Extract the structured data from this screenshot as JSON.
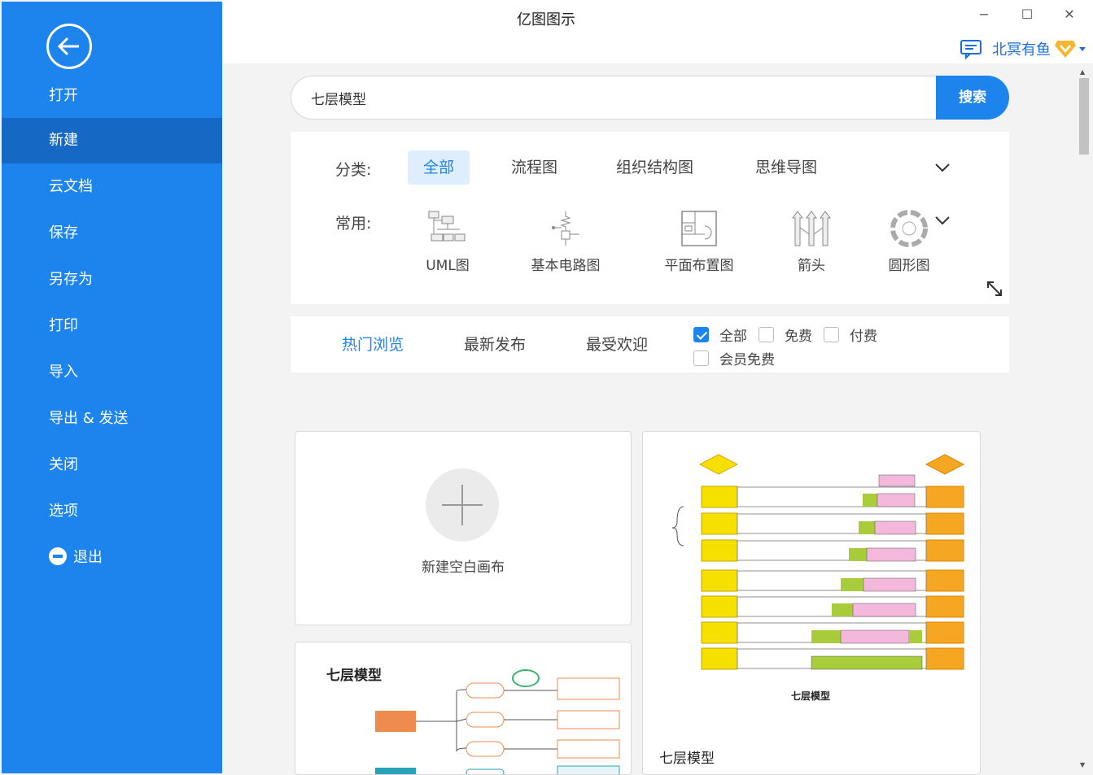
{
  "app": {
    "title": "亿图图示"
  },
  "window": {
    "minimize": "−",
    "maximize": "☐",
    "close": "✕"
  },
  "user": {
    "name": "北冥有鱼"
  },
  "sidebar": {
    "items": [
      {
        "label": "打开"
      },
      {
        "label": "新建"
      },
      {
        "label": "云文档"
      },
      {
        "label": "保存"
      },
      {
        "label": "另存为"
      },
      {
        "label": "打印"
      },
      {
        "label": "导入"
      },
      {
        "label": "导出 & 发送"
      },
      {
        "label": "关闭"
      },
      {
        "label": "选项"
      },
      {
        "label": "退出"
      }
    ],
    "active": "新建"
  },
  "search": {
    "value": "七层模型",
    "button": "搜索"
  },
  "category": {
    "label": "分类:",
    "tabs": [
      {
        "label": "全部"
      },
      {
        "label": "流程图"
      },
      {
        "label": "组织结构图"
      },
      {
        "label": "思维导图"
      }
    ],
    "common_label": "常用:",
    "tools": [
      {
        "label": "UML图"
      },
      {
        "label": "基本电路图"
      },
      {
        "label": "平面布置图"
      },
      {
        "label": "箭头"
      },
      {
        "label": "圆形图"
      }
    ]
  },
  "filter": {
    "tabs": [
      {
        "label": "热门浏览"
      },
      {
        "label": "最新发布"
      },
      {
        "label": "最受欢迎"
      }
    ],
    "checks": [
      {
        "label": "全部",
        "checked": true
      },
      {
        "label": "免费",
        "checked": false
      },
      {
        "label": "付费",
        "checked": false
      },
      {
        "label": "会员免费",
        "checked": false
      }
    ]
  },
  "cards": {
    "new_blank": "新建空白画布",
    "tpl1_title": "七层模型",
    "tpl1_caption": "七层模型",
    "tpl2_title": "七层模型"
  },
  "colors": {
    "accent": "#1c84ec",
    "sidebar_active": "#1568c4"
  }
}
